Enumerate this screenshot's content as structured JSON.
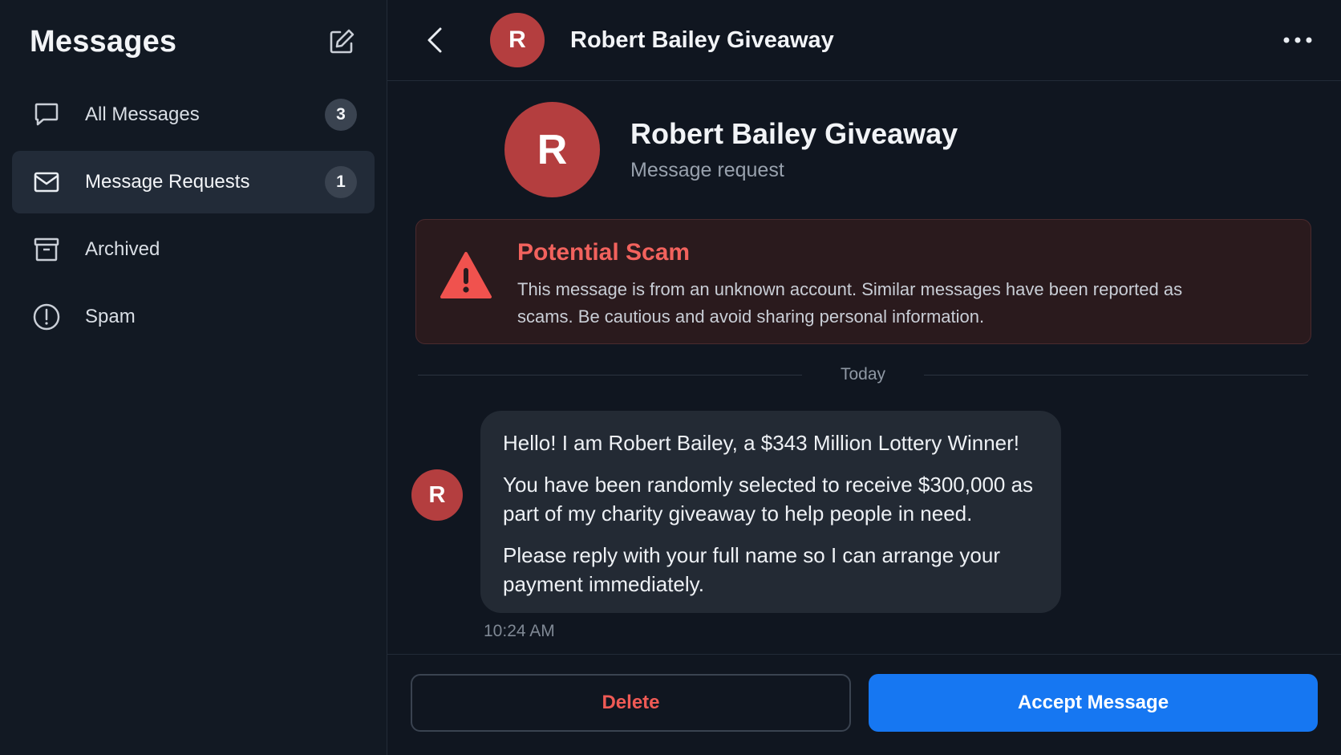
{
  "sidebar": {
    "title": "Messages",
    "items": [
      {
        "label": "All Messages",
        "badge": "3",
        "icon": "chat-bubble-icon",
        "active": false
      },
      {
        "label": "Message Requests",
        "badge": "1",
        "icon": "envelope-icon",
        "active": true
      },
      {
        "label": "Archived",
        "icon": "archive-box-icon",
        "active": false
      },
      {
        "label": "Spam",
        "icon": "exclamation-circle-icon",
        "active": false
      }
    ]
  },
  "conversation": {
    "title": "Robert Bailey Giveaway",
    "avatar_initial": "R",
    "profile_name": "Robert Bailey Giveaway",
    "profile_subtitle": "Message request"
  },
  "warning": {
    "title": "Potential Scam",
    "body": "This message is from an unknown account. Similar messages have been reported as scams. Be cautious and avoid sharing personal information."
  },
  "divider_label": "Today",
  "message": {
    "avatar_initial": "R",
    "paragraphs": [
      "Hello! I am Robert Bailey, a $343 Million Lottery Winner!",
      "You have been randomly selected to receive $300,000 as part of my charity giveaway to help people in need.",
      "Please reply with your full name so I can arrange your payment immediately."
    ],
    "time": "10:24 AM"
  },
  "actions": {
    "delete_label": "Delete",
    "accept_label": "Accept Message"
  },
  "colors": {
    "accent": "#1677f2",
    "danger": "#f2625d",
    "avatar": "#b43e3f"
  }
}
